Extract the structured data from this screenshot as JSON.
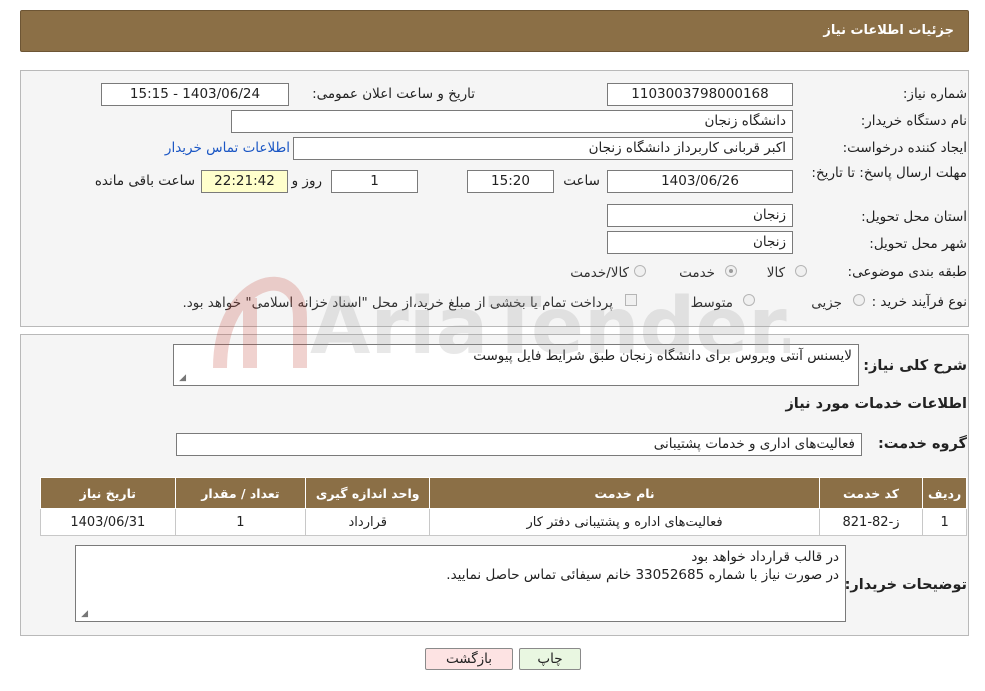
{
  "header": {
    "title": "جزئیات اطلاعات نیاز"
  },
  "form": {
    "need_number_label": "شماره نیاز:",
    "need_number": "1103003798000168",
    "announce_label": "تاریخ و ساعت اعلان عمومی:",
    "announce_value": "1403/06/24 - 15:15",
    "buyer_org_label": "نام دستگاه خریدار:",
    "buyer_org": "دانشگاه زنجان",
    "creator_label": "ایجاد کننده درخواست:",
    "creator": "اکبر قربانی کاربرداز دانشگاه زنجان",
    "contact_link": "اطلاعات تماس خریدار",
    "deadline_label": "مهلت ارسال پاسخ: تا تاریخ:",
    "deadline_date": "1403/06/26",
    "time_label": "ساعت",
    "deadline_time": "15:20",
    "days_value": "1",
    "days_label": "روز و",
    "remaining_time": "22:21:42",
    "remaining_label": "ساعت باقی مانده",
    "province_label": "استان محل تحویل:",
    "province": "زنجان",
    "city_label": "شهر محل تحویل:",
    "city": "زنجان",
    "category_label": "طبقه بندی موضوعی:",
    "category_options": [
      "کالا",
      "خدمت",
      "کالا/خدمت"
    ],
    "category_selected": "خدمت",
    "process_label": "نوع فرآیند خرید :",
    "process_options": [
      "جزیی",
      "متوسط"
    ],
    "payment_note": "پرداخت تمام یا بخشی از مبلغ خرید،از محل \"اسناد خزانه اسلامی\" خواهد بود."
  },
  "details": {
    "summary_label": "شرح کلی نیاز:",
    "summary": "لایسنس آنتی ویروس برای دانشگاه زنجان طبق شرایط فایل پیوست",
    "services_title": "اطلاعات خدمات مورد نیاز",
    "service_group_label": "گروه خدمت:",
    "service_group": "فعالیت‌های اداری و خدمات پشتیبانی",
    "table": {
      "headers": [
        "ردیف",
        "کد خدمت",
        "نام خدمت",
        "واحد اندازه گیری",
        "تعداد / مقدار",
        "تاریخ نیاز"
      ],
      "rows": [
        [
          "1",
          "ز-82-821",
          "فعالیت‌های اداره و پشتیبانی دفتر کار",
          "قرارداد",
          "1",
          "1403/06/31"
        ]
      ]
    },
    "buyer_notes_label": "توضیحات خریدار:",
    "buyer_notes_line1": "در قالب قرارداد خواهد بود",
    "buyer_notes_line2": "در صورت نیاز با شماره 33052685 خانم سیفائی تماس حاصل نمایید."
  },
  "buttons": {
    "print": "چاپ",
    "back": "بازگشت"
  },
  "watermark": {
    "text": "AriaTender.neT"
  },
  "colors": {
    "header_bg": "#8b6f46",
    "link": "#1a56c4",
    "back_button_bg": "#fde3e3",
    "print_button_bg": "#e9f7e1"
  }
}
